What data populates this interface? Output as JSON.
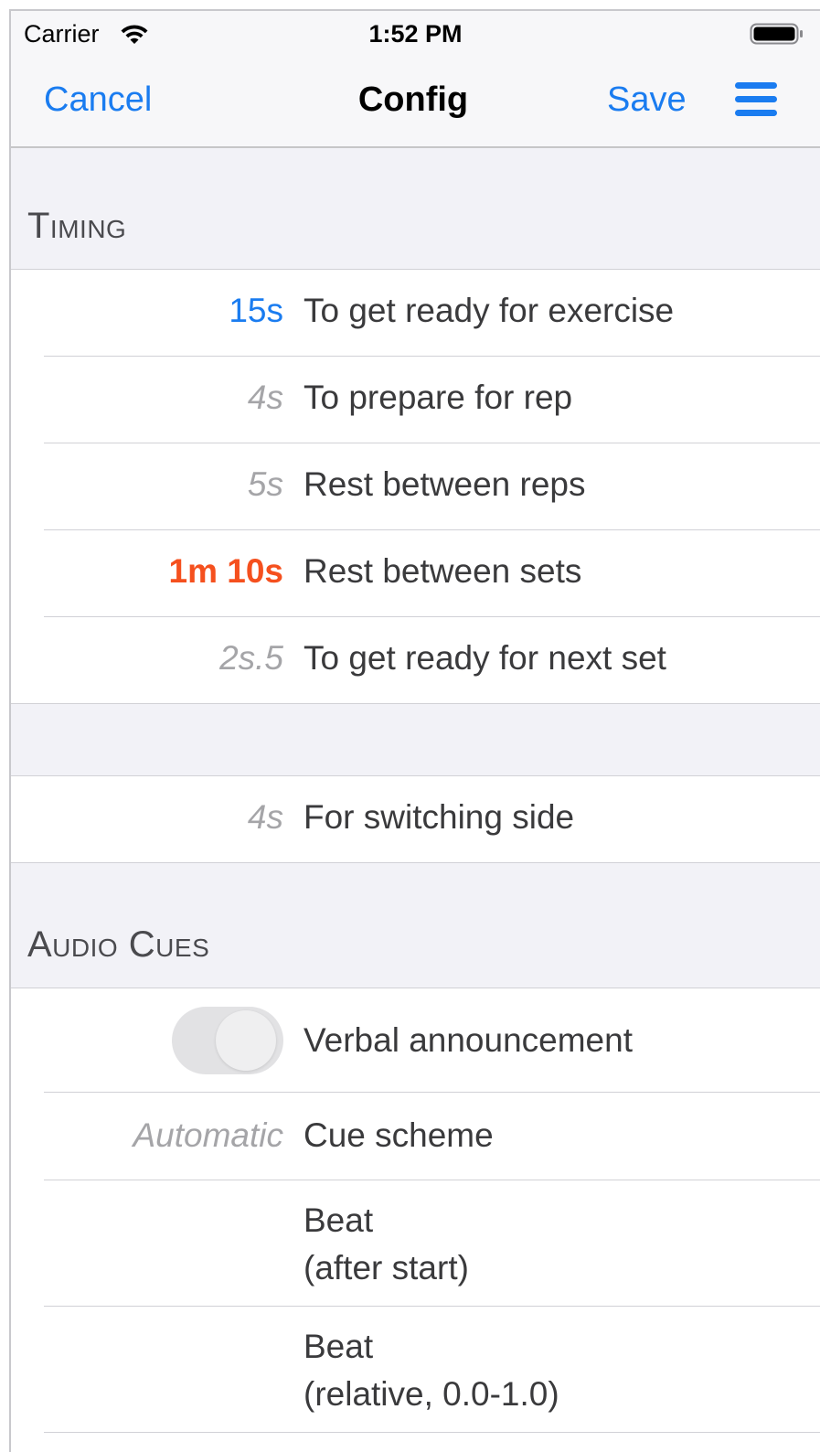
{
  "status_bar": {
    "carrier": "Carrier",
    "time": "1:52 PM"
  },
  "nav": {
    "cancel": "Cancel",
    "title": "Config",
    "save": "Save",
    "menu_icon": "hamburger-menu-icon"
  },
  "timing": {
    "header": "Timing",
    "rows": [
      {
        "value": "15s",
        "label": "To get ready for exercise",
        "style": "blue"
      },
      {
        "value": "4s",
        "label": "To prepare for rep",
        "style": "gray"
      },
      {
        "value": "5s",
        "label": "Rest between reps",
        "style": "gray"
      },
      {
        "value": "1m 10s",
        "label": "Rest between sets",
        "style": "orange"
      },
      {
        "value": "2s.5",
        "label": "To get ready for next set",
        "style": "gray"
      }
    ],
    "switch_row": {
      "value": "4s",
      "label": "For switching side"
    }
  },
  "audio_cues": {
    "header": "Audio Cues",
    "verbal": {
      "label": "Verbal announcement",
      "enabled": false
    },
    "cue_scheme": {
      "value": "Automatic",
      "label": "Cue scheme"
    },
    "beat_after_start": {
      "line1": "Beat",
      "line2": "(after start)"
    },
    "beat_relative": {
      "line1": "Beat",
      "line2": "(relative, 0.0-1.0)"
    }
  },
  "colors": {
    "accent": "#1a7cf0",
    "highlight": "#f5501e",
    "muted": "#a5a5a8",
    "background": "#f2f2f7"
  }
}
